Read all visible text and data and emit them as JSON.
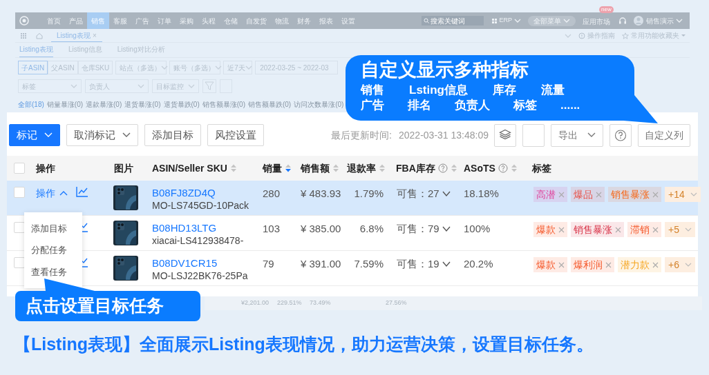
{
  "header": {
    "nav": [
      {
        "label": "首页",
        "selected": false
      },
      {
        "label": "产品",
        "selected": false
      },
      {
        "label": "销售",
        "selected": true
      },
      {
        "label": "客服",
        "selected": false
      },
      {
        "label": "广告",
        "selected": false
      },
      {
        "label": "订单",
        "selected": false
      },
      {
        "label": "采购",
        "selected": false
      },
      {
        "label": "头程",
        "selected": false
      },
      {
        "label": "仓储",
        "selected": false
      },
      {
        "label": "自发货",
        "selected": false
      },
      {
        "label": "物流",
        "selected": false
      },
      {
        "label": "财务",
        "selected": false
      },
      {
        "label": "报表",
        "selected": false
      },
      {
        "label": "设置",
        "selected": false
      }
    ],
    "search": {
      "placeholder": "搜索关键词"
    },
    "erp": "ERP",
    "all_menu": "全部菜单",
    "app_market": "应用市场",
    "badge": "new",
    "user": "销售演示"
  },
  "tab_bar": {
    "tab": "Listing表现",
    "close": "×",
    "links": [
      "操作指南",
      "常用功能收藏夹"
    ]
  },
  "sub_tabs": [
    {
      "label": "Listing表现",
      "selected": true
    },
    {
      "label": "Listing信息",
      "selected": false
    },
    {
      "label": "Listing对比分析",
      "selected": false
    }
  ],
  "filters": {
    "segments": [
      {
        "label": "子ASIN",
        "selected": true
      },
      {
        "label": "父ASIN",
        "selected": false
      },
      {
        "label": "仓库SKU",
        "selected": false
      }
    ],
    "selects": [
      "站点（多选）",
      "账号（多选）",
      "近7天"
    ],
    "date": "2022-03-25 ~ 2022-03",
    "selects_2": [
      "标签",
      "负责人",
      "目标监控"
    ]
  },
  "status_tabs": [
    {
      "label": "全部(18)",
      "selected": true
    },
    {
      "label": "销量暴涨(0)",
      "selected": false
    },
    {
      "label": "退款暴涨(0)",
      "selected": false
    },
    {
      "label": "退货暴涨(0)",
      "selected": false
    },
    {
      "label": "退货暴跌(0)",
      "selected": false
    },
    {
      "label": "销售额暴涨(0)",
      "selected": false
    },
    {
      "label": "销售额暴跌(0)",
      "selected": false
    },
    {
      "label": "访问次数暴涨(0)",
      "selected": false
    }
  ],
  "toolbar": {
    "buttons": [
      {
        "label": "标记",
        "kind": "primary"
      },
      {
        "label": "取消标记",
        "kind": "dropdown"
      },
      {
        "label": "添加目标",
        "kind": "plain"
      },
      {
        "label": "风控设置",
        "kind": "plain"
      }
    ],
    "updated_label": "最后更新时间:",
    "updated_time": "2022-03-31 13:48:09",
    "right_buttons": [
      {
        "kind": "layers"
      },
      {
        "kind": "blank"
      },
      {
        "kind": "dropdown",
        "label": "导出"
      },
      {
        "kind": "help"
      },
      {
        "kind": "plain",
        "label": "自定义列"
      }
    ]
  },
  "table": {
    "header_checked": false,
    "columns": [
      {
        "label": "操作"
      },
      {
        "label": "图片"
      },
      {
        "label": "ASIN/Seller SKU",
        "sortable": true,
        "sorted": false
      },
      {
        "label": "销量",
        "sortable": true,
        "sorted": true
      },
      {
        "label": "销售额",
        "sortable": true,
        "sorted": false
      },
      {
        "label": "退款率",
        "sortable": true,
        "sorted": false
      },
      {
        "label": "FBA库存",
        "help": true,
        "sortable": true,
        "sorted": false
      },
      {
        "label": "ASoTS",
        "help": true,
        "sortable": true,
        "sorted": false
      },
      {
        "label": "标签"
      }
    ],
    "rows": [
      {
        "checked": false,
        "selected": true,
        "action": "操作",
        "expanded": true,
        "asin": "B08FJ8ZD4Q",
        "sku": "MO-LS745GD-10Pack",
        "sales": "280",
        "revenue": "¥ 483.93",
        "refund_rate": "1.79%",
        "fba": "可售：27",
        "asots": "18.18%",
        "tags": [
          {
            "label": "高潜",
            "color": "#e0409a"
          },
          {
            "label": "爆品",
            "color": "#e8534a"
          },
          {
            "label": "销售暴涨",
            "color": "#f56a1d"
          }
        ],
        "more": "+14"
      },
      {
        "checked": false,
        "selected": false,
        "asin": "B08HD13LTG",
        "sku": "xiacai-LS412938478-",
        "sales": "103",
        "revenue": "¥ 385.00",
        "refund_rate": "6.8%",
        "fba": "可售：79",
        "asots": "100%",
        "tags": [
          {
            "label": "爆款",
            "color": "#f5592b"
          },
          {
            "label": "销售暴涨",
            "color": "#d9364a"
          },
          {
            "label": "滞销",
            "color": "#f5592b"
          }
        ],
        "more": "+5"
      },
      {
        "checked": false,
        "selected": false,
        "asin": "B08DV1CR15",
        "sku": "MO-LSJ22BK76-25Pa",
        "sales": "79",
        "revenue": "¥ 391.00",
        "refund_rate": "7.59%",
        "fba": "可售：19",
        "asots": "20.2%",
        "tags": [
          {
            "label": "爆款",
            "color": "#f5592b"
          },
          {
            "label": "爆利润",
            "color": "#f5592b"
          },
          {
            "label": "潜力款",
            "color": "#f5a623"
          }
        ],
        "more": "+6"
      }
    ]
  },
  "action_menu": [
    "添加目标",
    "分配任务",
    "查看任务"
  ],
  "totals": [
    "¥2,201.00",
    "229.51%",
    "73.49%",
    "27.56%"
  ],
  "callout_columns": {
    "title": "自定义显示多种指标",
    "lines": [
      [
        "销售",
        "Lsting信息",
        "库存",
        "流量"
      ],
      [
        "广告",
        "排名",
        "负责人",
        "标签",
        "......"
      ]
    ]
  },
  "callout_task": "点击设置目标任务",
  "caption": "【Listing表现】全面展示Listing表现情况，助力运营决策，设置目标任务。"
}
